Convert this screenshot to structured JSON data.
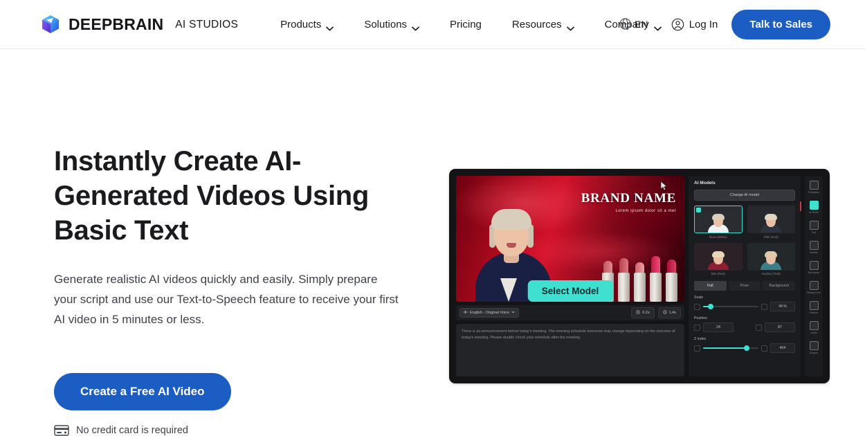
{
  "colors": {
    "brand_blue": "#1C5DC4",
    "accent_cyan": "#3FE0D0",
    "text_dark": "#1a1b1f",
    "text_body": "#3f4248",
    "app_bg": "#141416"
  },
  "header": {
    "logo_icon": "deepbrain-cube-logo-icon",
    "brand_name": "DEEPBRAIN",
    "brand_sub": "AI STUDIOS",
    "nav": [
      {
        "label": "Products",
        "has_caret": true
      },
      {
        "label": "Solutions",
        "has_caret": true
      },
      {
        "label": "Pricing",
        "has_caret": false
      },
      {
        "label": "Resources",
        "has_caret": true
      },
      {
        "label": "Company",
        "has_caret": true
      }
    ],
    "language": {
      "icon": "globe-icon",
      "label": "EN",
      "caret": true
    },
    "login": {
      "icon": "user-circle-icon",
      "label": "Log In"
    },
    "cta": "Talk to Sales"
  },
  "hero": {
    "headline": "Instantly Create AI-Generated Videos Using Basic Text",
    "subhead": "Generate realistic AI videos quickly and easily. Simply prepare your script and use our Text-to-Speech feature to receive your first AI video in 5 minutes or less.",
    "cta_label": "Create a Free AI Video",
    "note_icon": "credit-card-icon",
    "note": "No credit card is required"
  },
  "preview": {
    "video": {
      "brand_title": "BRAND NAME",
      "brand_subtitle": "Lorem ipsum dolor sit a met",
      "select_model_button": "Select Model"
    },
    "toolbar": {
      "voice_icon": "waveform-icon",
      "voice_chip": "English - Original Voice",
      "duration_icon": "clock-icon",
      "duration": "0.2s",
      "total_icon": "clock-icon",
      "total": "1.4s"
    },
    "script": "There is an announcement before today's meeting. The morning schedule tomorrow may change depending on the outcome of today's meeting. Please double check your schedule after the meeting.",
    "panel": {
      "title": "AI Models",
      "change_button": "Change AI model",
      "models": [
        {
          "name": "Nora (White)",
          "selected": true,
          "hair": "#d9cdbc",
          "shirt": "#f0f1f3"
        },
        {
          "name": "Ellie (Suit)",
          "selected": false,
          "hair": "#e0d4c2",
          "shirt": "#2f3340"
        },
        {
          "name": "Mia (Red)",
          "selected": false,
          "hair": "#e8d7b6",
          "shirt": "#8d2030"
        },
        {
          "name": "Sophia (Teal)",
          "selected": false,
          "hair": "#ddc9a8",
          "shirt": "#3c7f86"
        }
      ],
      "tabs": [
        {
          "label": "Full",
          "active": true
        },
        {
          "label": "Pose",
          "active": false
        },
        {
          "label": "Background",
          "active": false
        }
      ],
      "controls": [
        {
          "label": "Scale",
          "value": "49 %",
          "pct": 12
        },
        {
          "label": "Position",
          "x": "24",
          "y": "87"
        },
        {
          "label": "Z index",
          "value": "404",
          "pct": 78
        }
      ]
    },
    "rail": [
      {
        "icon": "templates-icon",
        "label": "Templates",
        "active": false
      },
      {
        "icon": "ai-model-icon",
        "label": "AI Model",
        "active": true
      },
      {
        "icon": "text-icon",
        "label": "Text",
        "active": false
      },
      {
        "icon": "subtitles-icon",
        "label": "Subtitle",
        "active": false
      },
      {
        "icon": "image-icon",
        "label": "My Assets",
        "active": false
      },
      {
        "icon": "background-icon",
        "label": "Background",
        "active": false
      },
      {
        "icon": "frames-icon",
        "label": "Frames",
        "active": false
      },
      {
        "icon": "audio-icon",
        "label": "Audio",
        "active": false
      },
      {
        "icon": "shapes-icon",
        "label": "Shapes",
        "active": false
      }
    ]
  }
}
